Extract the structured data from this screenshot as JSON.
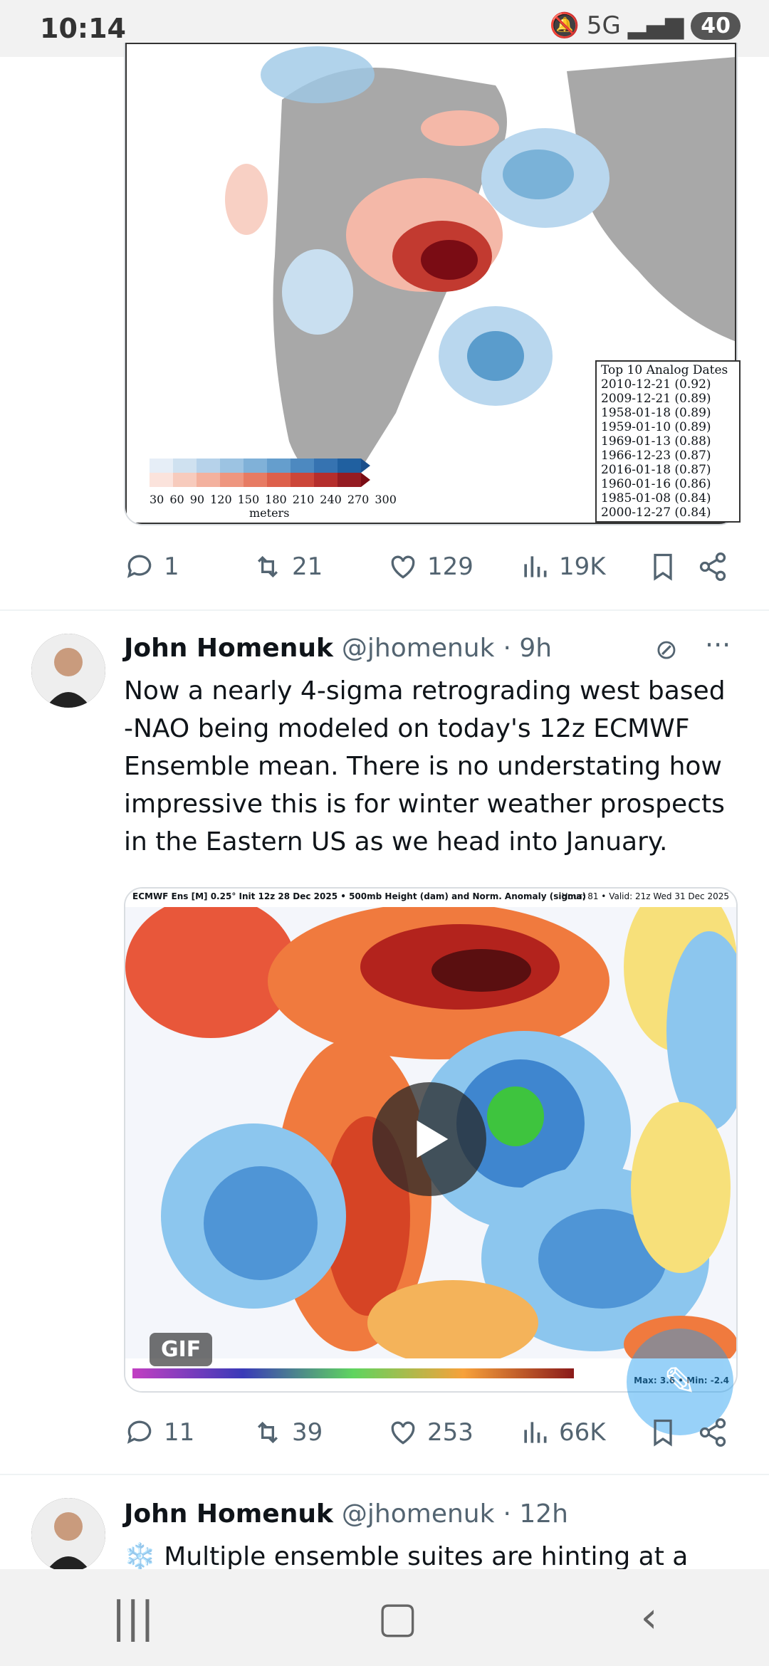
{
  "status": {
    "time": "10:14",
    "network": "5G",
    "battery": "40"
  },
  "tweet1": {
    "analog_title": "Top 10 Analog Dates",
    "analogs": [
      "2010-12-21 (0.92)",
      "2009-12-21 (0.89)",
      "1958-01-18 (0.89)",
      "1959-01-10 (0.89)",
      "1969-01-13 (0.88)",
      "1966-12-23 (0.87)",
      "2016-01-18 (0.87)",
      "1960-01-16 (0.86)",
      "1985-01-08 (0.84)",
      "2000-12-27 (0.84)"
    ],
    "colorbar_ticks": [
      "30",
      "60",
      "90",
      "120",
      "150",
      "180",
      "210",
      "240",
      "270",
      "300"
    ],
    "colorbar_unit": "meters",
    "replies": "1",
    "retweets": "21",
    "likes": "129",
    "views": "19K"
  },
  "tweet2": {
    "name": "John Homenuk",
    "handle": "@jhomenuk",
    "time": "· 9h",
    "text": "Now a nearly 4-sigma retrograding west based -NAO being modeled on today's 12z ECMWF Ensemble mean. There is no understating how impressive this is for winter weather prospects in the Eastern US as we head into January.",
    "map_header": "ECMWF Ens [M] 0.25° Init 12z 28 Dec 2025 • 500mb Height (dam) and Norm. Anomaly (sigma)",
    "map_valid": "Hour: 81 • Valid: 21z Wed 31 Dec 2025",
    "gif_label": "GIF",
    "max_min": "Max: 3.6 • Min: -2.4",
    "replies": "11",
    "retweets": "39",
    "likes": "253",
    "views": "66K"
  },
  "tweet3": {
    "name": "John Homenuk",
    "handle": "@jhomenuk",
    "time": "· 12h",
    "text": "❄️ Multiple ensemble suites are hinting at a"
  }
}
